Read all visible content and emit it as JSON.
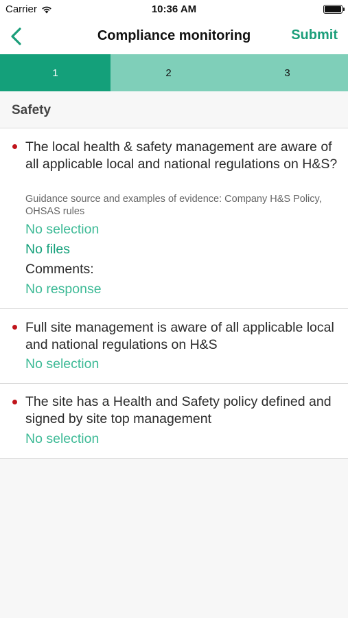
{
  "status_bar": {
    "carrier": "Carrier",
    "time": "10:36 AM",
    "wifi_icon": "wifi-icon",
    "battery_icon": "battery-icon"
  },
  "nav": {
    "title": "Compliance monitoring",
    "submit_label": "Submit",
    "back_icon": "chevron-left-icon"
  },
  "stepper": {
    "steps": [
      {
        "label": "1",
        "active": true
      },
      {
        "label": "2",
        "active": false
      },
      {
        "label": "3",
        "active": false
      }
    ]
  },
  "section": {
    "title": "Safety"
  },
  "questions": [
    {
      "text": "The local health & safety management are aware of all applicable local and national regulations on H&S?",
      "guidance": "Guidance source and examples of evidence: Company H&S Policy, OHSAS rules",
      "selection": "No selection",
      "files": "No files",
      "comments_label": "Comments:",
      "comments_value": "No response"
    },
    {
      "text": "Full site management is aware of all applicable local and national regulations on H&S",
      "selection": "No selection"
    },
    {
      "text": "The site has a Health and Safety policy defined and signed by site top management",
      "selection": "No selection"
    }
  ],
  "colors": {
    "accent": "#14a07a",
    "accent_light": "#7fcfb9",
    "link": "#3dba96",
    "required_dot": "#c0141b"
  }
}
